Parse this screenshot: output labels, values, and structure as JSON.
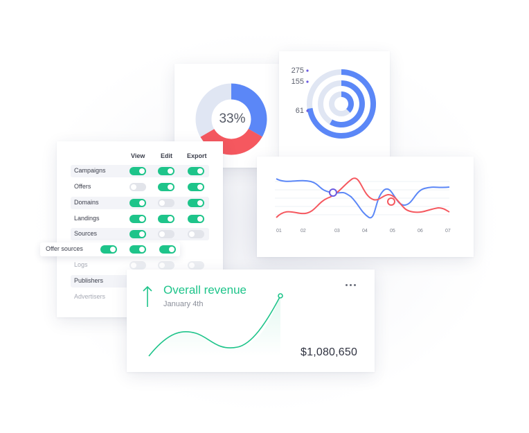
{
  "colors": {
    "blue": "#5b87f7",
    "red": "#f5585f",
    "light_blue": "#e0e6f3",
    "green": "#1ec48a",
    "purple": "#6a5ae0"
  },
  "donut": {
    "percent_label": "33%",
    "segments": [
      {
        "value": 33,
        "color": "#5b87f7"
      },
      {
        "value": 25,
        "color": "#f5585f"
      },
      {
        "value": 42,
        "color": "#e0e6f3"
      }
    ]
  },
  "radial": {
    "ticks": [
      "275",
      "155",
      "61"
    ]
  },
  "permissions": {
    "columns": [
      "View",
      "Edit",
      "Export"
    ],
    "rows": [
      {
        "label": "Campaigns",
        "toggles": [
          true,
          true,
          true
        ]
      },
      {
        "label": "Offers",
        "toggles": [
          false,
          true,
          true
        ]
      },
      {
        "label": "Domains",
        "toggles": [
          true,
          false,
          true
        ]
      },
      {
        "label": "Landings",
        "toggles": [
          true,
          true,
          true
        ]
      },
      {
        "label": "Sources",
        "toggles": [
          true,
          false,
          false
        ]
      },
      {
        "label": "Offer sources",
        "toggles": [
          true,
          true,
          true
        ]
      },
      {
        "label": "Logs",
        "toggles": [
          false,
          false,
          false
        ]
      },
      {
        "label": "Publishers",
        "toggles": [
          false,
          false,
          false
        ]
      },
      {
        "label": "Advertisers",
        "toggles": [
          false,
          false,
          false
        ]
      }
    ]
  },
  "line_chart": {
    "x_ticks": [
      "01",
      "02",
      "03",
      "04",
      "05",
      "06",
      "07"
    ]
  },
  "revenue": {
    "title": "Overall revenue",
    "date": "January 4th",
    "amount": "$1,080,650",
    "trend_icon": "arrow-up-icon",
    "menu_icon": "more-horizontal-icon"
  }
}
